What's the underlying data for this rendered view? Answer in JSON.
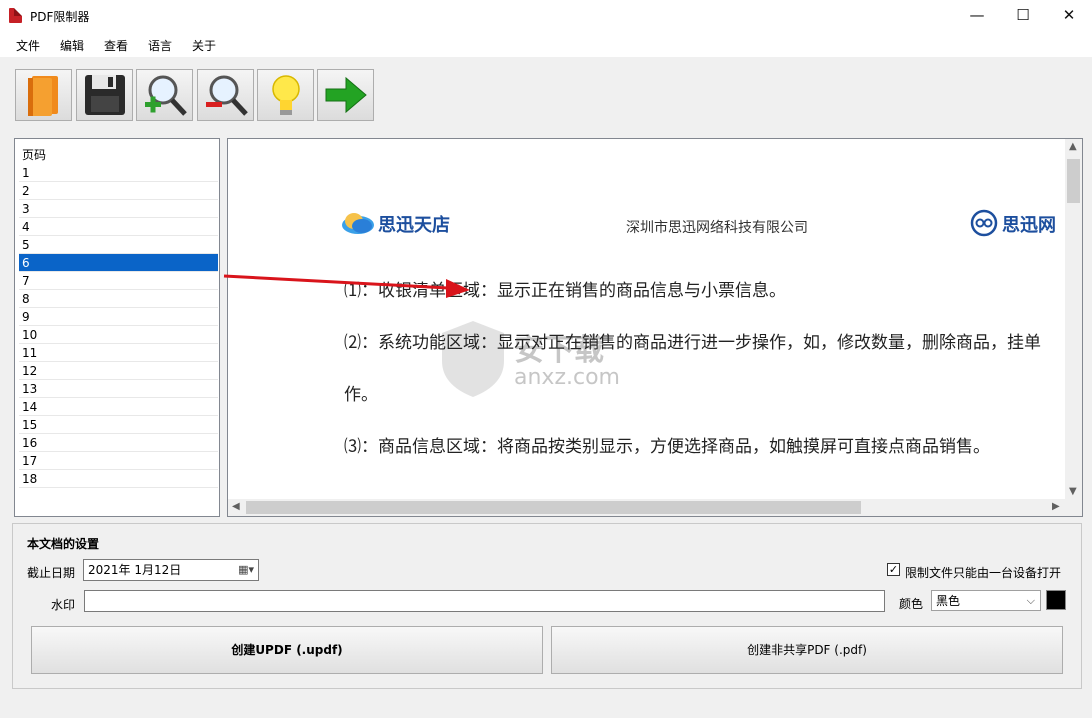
{
  "window": {
    "title": "PDF限制器",
    "minimize": "—",
    "maximize": "☐",
    "close": "✕"
  },
  "menu": {
    "file": "文件",
    "edit": "编辑",
    "view": "查看",
    "language": "语言",
    "about": "关于"
  },
  "toolbar": {
    "icons": [
      "open-book-icon",
      "save-icon",
      "zoom-in-icon",
      "zoom-out-icon",
      "lightbulb-icon",
      "next-arrow-icon"
    ]
  },
  "pages": {
    "header": "页码",
    "items": [
      "1",
      "2",
      "3",
      "4",
      "5",
      "6",
      "7",
      "8",
      "9",
      "10",
      "11",
      "12",
      "13",
      "14",
      "15",
      "16",
      "17",
      "18"
    ],
    "selected": "6"
  },
  "document": {
    "brand_left": "思迅天店",
    "company": "深圳市思迅网络科技有限公司",
    "brand_right": "思迅网",
    "line1": "⑴：收银清单区域：显示正在销售的商品信息与小票信息。",
    "line2": "⑵：系统功能区域：显示对正在销售的商品进行进一步操作，如，修改数量，删除商品，挂单",
    "line3": "作。",
    "line4": "⑶：商品信息区域：将商品按类别显示，方便选择商品，如触摸屏可直接点商品销售。",
    "watermark_cn": "安下载",
    "watermark_en": "anxz.com"
  },
  "settings": {
    "title": "本文档的设置",
    "expiry_label": "截止日期",
    "expiry_value": "2021年  1月12日",
    "restrict_label": "限制文件只能由一台设备打开",
    "restrict_checked": true,
    "watermark_label": "水印",
    "watermark_value": "",
    "color_label": "颜色",
    "color_value": "黑色",
    "color_swatch": "#000000",
    "create_updf": "创建UPDF (.updf)",
    "create_pdf": "创建非共享PDF (.pdf)"
  },
  "colors": {
    "selection": "#0a64c8",
    "brand_blue": "#1d4f9e",
    "arrow_red": "#d9141b"
  }
}
